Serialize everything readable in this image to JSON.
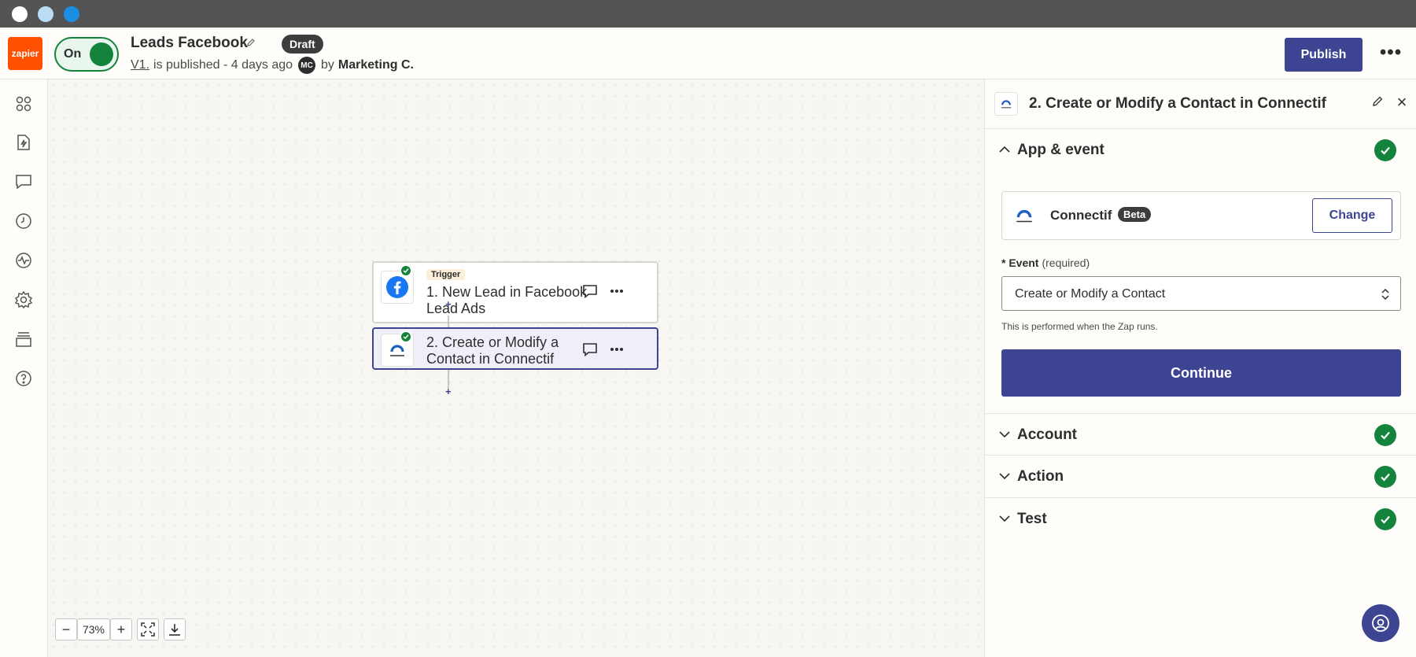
{
  "header": {
    "logo": "zapier",
    "toggle_label": "On",
    "zap_title": "Leads Facebook",
    "status_badge": "Draft",
    "version_link": "V1.",
    "published_text": "is published - 4 days ago",
    "avatar_initials": "MC",
    "by_text": "by",
    "by_name": "Marketing C.",
    "publish_label": "Publish",
    "more_label": "•••"
  },
  "sidebar": {
    "items": [
      {
        "icon": "apps-icon"
      },
      {
        "icon": "file-bolt-icon"
      },
      {
        "icon": "comment-icon"
      },
      {
        "icon": "history-icon"
      },
      {
        "icon": "activity-icon"
      },
      {
        "icon": "settings-icon"
      },
      {
        "icon": "versions-icon"
      },
      {
        "icon": "help-icon"
      }
    ]
  },
  "canvas": {
    "steps": [
      {
        "badge": "Trigger",
        "title": "1. New Lead in Facebook Lead Ads",
        "app": "Facebook Lead Ads"
      },
      {
        "title": "2. Create or Modify a Contact in Connectif",
        "app": "Connectif"
      }
    ],
    "zoom": {
      "minus": "−",
      "value": "73%",
      "plus": "+"
    }
  },
  "panel": {
    "title": "2. Create or Modify a Contact in Connectif",
    "sections": {
      "app_event": "App & event",
      "account": "Account",
      "action": "Action",
      "test": "Test"
    },
    "app_name": "Connectif",
    "app_badge": "Beta",
    "change_label": "Change",
    "event_label": "Event",
    "event_required": "(required)",
    "event_value": "Create or Modify a Contact",
    "hint": "This is performed when the Zap runs.",
    "continue_label": "Continue"
  },
  "colors": {
    "brand_orange": "#ff4f00",
    "primary": "#3d4592",
    "success": "#14833b"
  }
}
